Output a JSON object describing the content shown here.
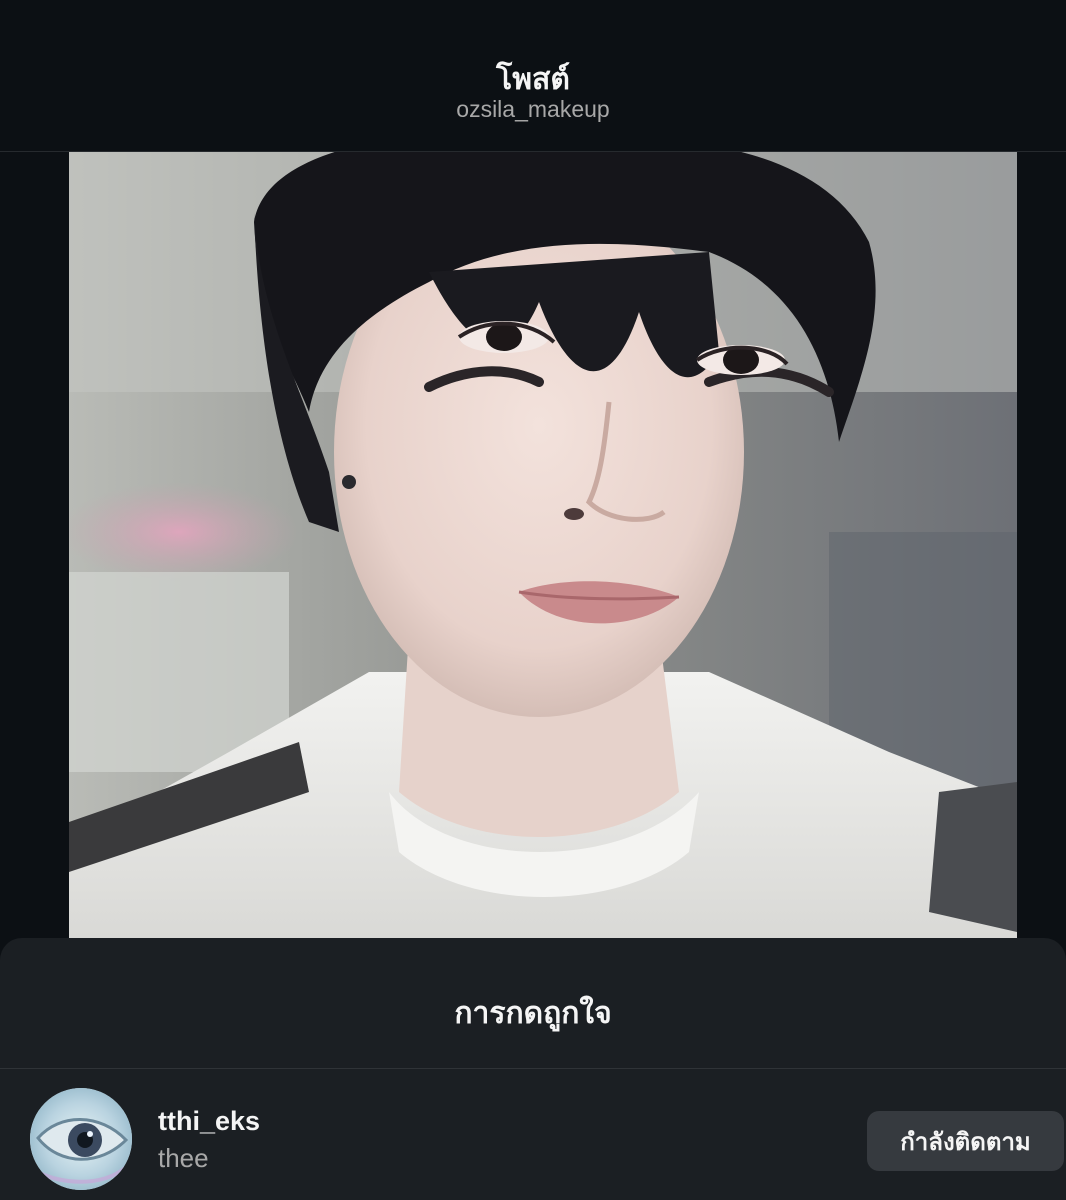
{
  "header": {
    "title": "โพสต์",
    "subtitle": "ozsila_makeup"
  },
  "post": {
    "image_alt": "photo"
  },
  "likes_sheet": {
    "title": "การกดถูกใจ",
    "users": [
      {
        "username": "tthi_eks",
        "full_name": "thee",
        "follow_label": "กำลังติดตาม"
      }
    ]
  },
  "colors": {
    "background": "#0c1014",
    "sheet": "#1b1f23",
    "button": "#363a3f",
    "secondary_text": "#a8a8a8"
  }
}
